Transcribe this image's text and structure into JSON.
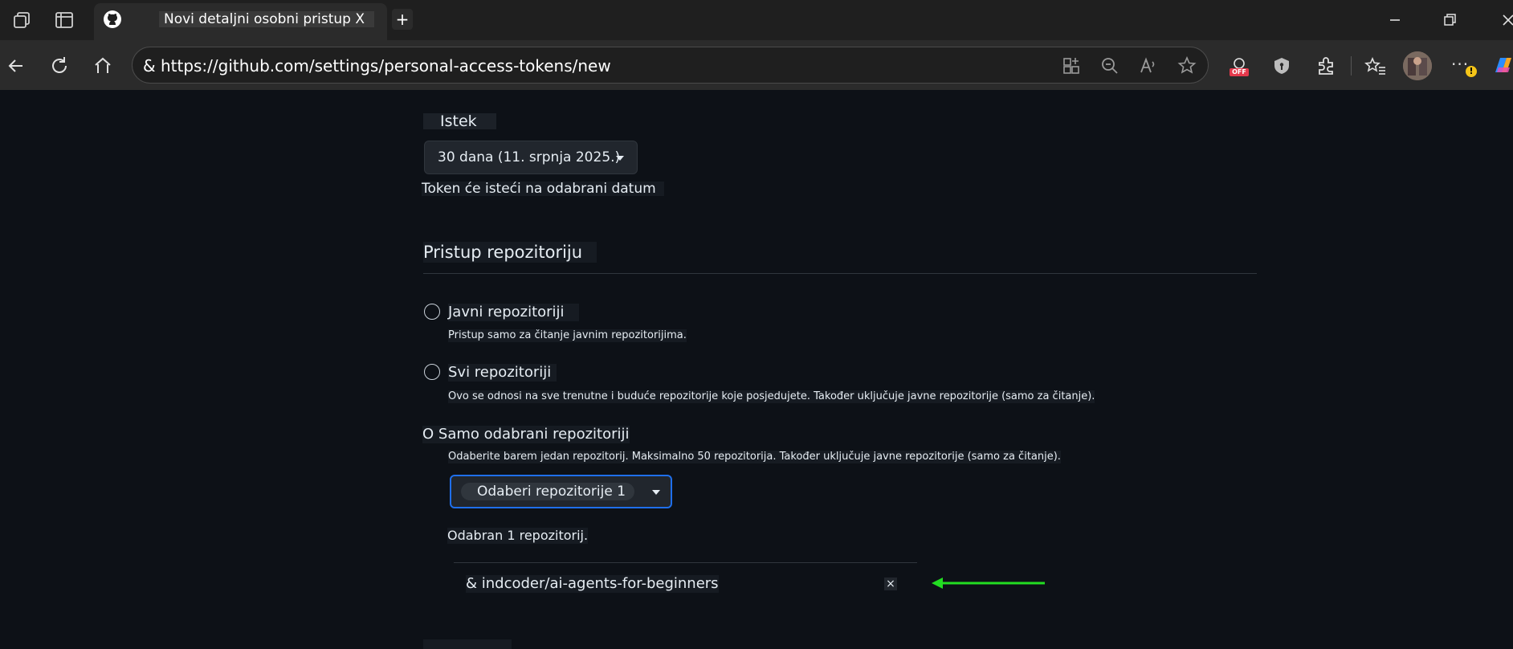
{
  "browser": {
    "tab_title": "Novi detaljni osobni pristup X",
    "new_tab_symbol": "+",
    "url": "& https://github.com/settings/personal-access-tokens/new",
    "off_badge": "OFF",
    "more_symbol": "···"
  },
  "expiration": {
    "label": "Istek",
    "selected": "30 dana (11. srpnja 2025.)",
    "note": "Token će isteći na odabrani datum"
  },
  "repository_access": {
    "heading": "Pristup repozitoriju",
    "options": [
      {
        "label": "Javni repozitoriji",
        "description": "Pristup samo za čitanje javnim repozitorijima."
      },
      {
        "label": "Svi repozitoriji",
        "description": "Ovo se odnosi na sve trenutne i buduće repozitorije koje posjedujete. Također uključuje javne repozitorije (samo za čitanje)."
      },
      {
        "label": "O Samo odabrani repozitoriji",
        "description": "Odaberite barem jedan repozitorij. Maksimalno 50 repozitorija. Također uključuje javne repozitorije (samo za čitanje)."
      }
    ],
    "select_button": "Odaberi repozitorije 1",
    "selected_count": "Odabran 1 repozitorij.",
    "selected_repo": "& indcoder/ai-agents-for-beginners",
    "remove_symbol": "×"
  },
  "colors": {
    "background": "#0d1117",
    "focus_border": "#1f6feb",
    "arrow": "#22dd22"
  }
}
